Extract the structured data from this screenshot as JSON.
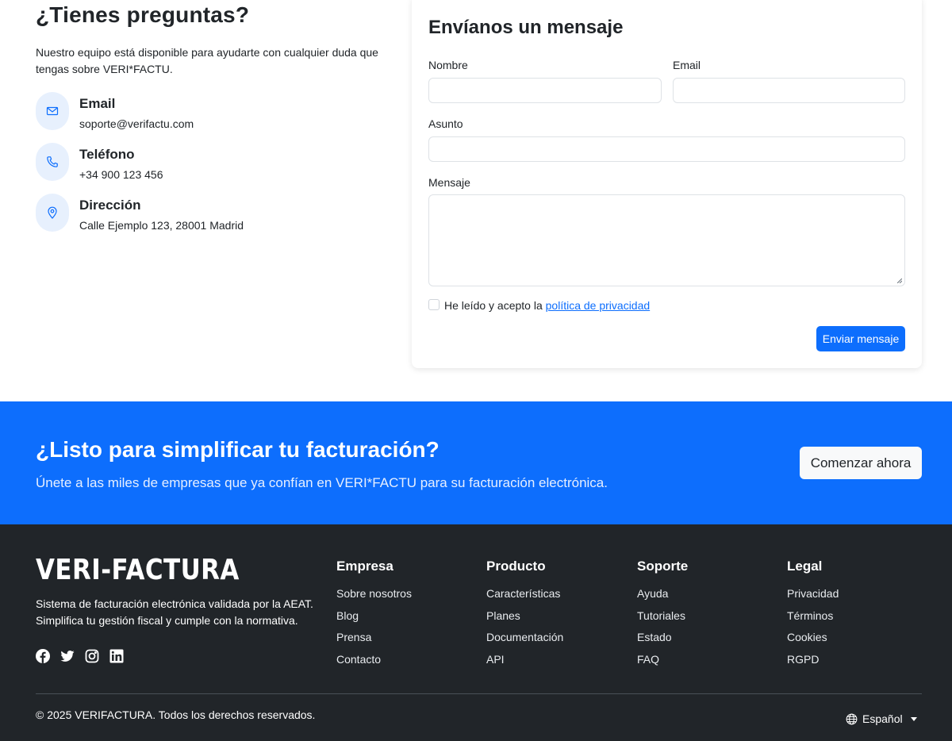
{
  "contact": {
    "heading": "¿Tienes preguntas?",
    "intro": "Nuestro equipo está disponible para ayudarte con cualquier duda que tengas sobre VERI*FACTU.",
    "items": [
      {
        "icon": "envelope-icon",
        "title": "Email",
        "value": "soporte@verifactu.com"
      },
      {
        "icon": "phone-icon",
        "title": "Teléfono",
        "value": "+34 900 123 456"
      },
      {
        "icon": "map-pin-icon",
        "title": "Dirección",
        "value": "Calle Ejemplo 123, 28001 Madrid"
      }
    ]
  },
  "form": {
    "title": "Envíanos un mensaje",
    "name_label": "Nombre",
    "name_value": "",
    "email_label": "Email",
    "email_value": "",
    "subject_label": "Asunto",
    "subject_value": "",
    "message_label": "Mensaje",
    "message_value": "",
    "consent_prefix": "He leído y acepto la ",
    "consent_link": "política de privacidad",
    "consent_checked": false,
    "submit_label": "Enviar mensaje"
  },
  "cta": {
    "heading": "¿Listo para simplificar tu facturación?",
    "text": "Únete a las miles de empresas que ya confían en VERI*FACTU para su facturación electrónica.",
    "button": "Comenzar ahora"
  },
  "footer": {
    "logo": "VERI-FACTURA",
    "description": "Sistema de facturación electrónica validada por la AEAT. Simplifica tu gestión fiscal y cumple con la normativa.",
    "social": [
      "facebook-icon",
      "twitter-icon",
      "instagram-icon",
      "linkedin-icon"
    ],
    "columns": [
      {
        "title": "Empresa",
        "links": [
          "Sobre nosotros",
          "Blog",
          "Prensa",
          "Contacto"
        ]
      },
      {
        "title": "Producto",
        "links": [
          "Características",
          "Planes",
          "Documentación",
          "API"
        ]
      },
      {
        "title": "Soporte",
        "links": [
          "Ayuda",
          "Tutoriales",
          "Estado",
          "FAQ"
        ]
      },
      {
        "title": "Legal",
        "links": [
          "Privacidad",
          "Términos",
          "Cookies",
          "RGPD"
        ]
      }
    ],
    "copyright": "© 2025 VERIFACTURA. Todos los derechos reservados.",
    "language": "Español"
  },
  "colors": {
    "primary": "#0d6efd",
    "dark": "#212529",
    "icon_bg": "#e7f0fd"
  }
}
